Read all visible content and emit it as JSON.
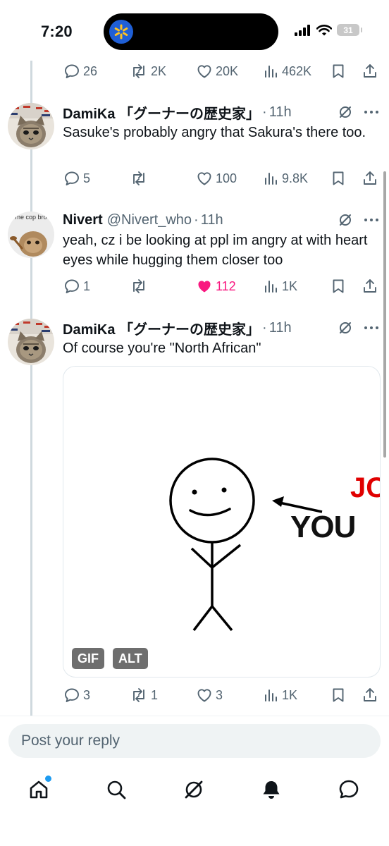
{
  "status_bar": {
    "time": "7:20",
    "battery": "31"
  },
  "top_actions": {
    "replies": "26",
    "reposts": "2K",
    "likes": "20K",
    "views": "462K"
  },
  "tweets": [
    {
      "name": "DamiKa 「グーナーの歴史家」",
      "handle": "",
      "time": "11h",
      "text": "Sasuke's probably angry that Sakura's there too.",
      "replies": "5",
      "reposts": "",
      "likes": "100",
      "views": "9.8K",
      "liked": false
    },
    {
      "name": "Nivert",
      "handle": "@Nivert_who",
      "time": "11h",
      "text": "yeah, cz i be looking at ppl im angry at with heart eyes while hugging them closer too",
      "replies": "1",
      "reposts": "",
      "likes": "112",
      "views": "1K",
      "liked": true,
      "avatar_text": "me cop bro"
    },
    {
      "name": "DamiKa 「グーナーの歴史家」",
      "handle": "",
      "time": "11h",
      "text": "Of course you're \"North African\"",
      "replies": "3",
      "reposts": "1",
      "likes": "3",
      "views": "1K",
      "liked": false,
      "media": {
        "label_you": "YOU",
        "label_partial": "JC",
        "badges": [
          "GIF",
          "ALT"
        ]
      }
    }
  ],
  "reply_placeholder": "Post your reply",
  "nav": [
    "home-icon",
    "search-icon",
    "grok-icon",
    "notifications-icon",
    "messages-icon"
  ],
  "colors": {
    "accent": "#1d9bf0",
    "like": "#f91880",
    "secondary_text": "#536471"
  }
}
